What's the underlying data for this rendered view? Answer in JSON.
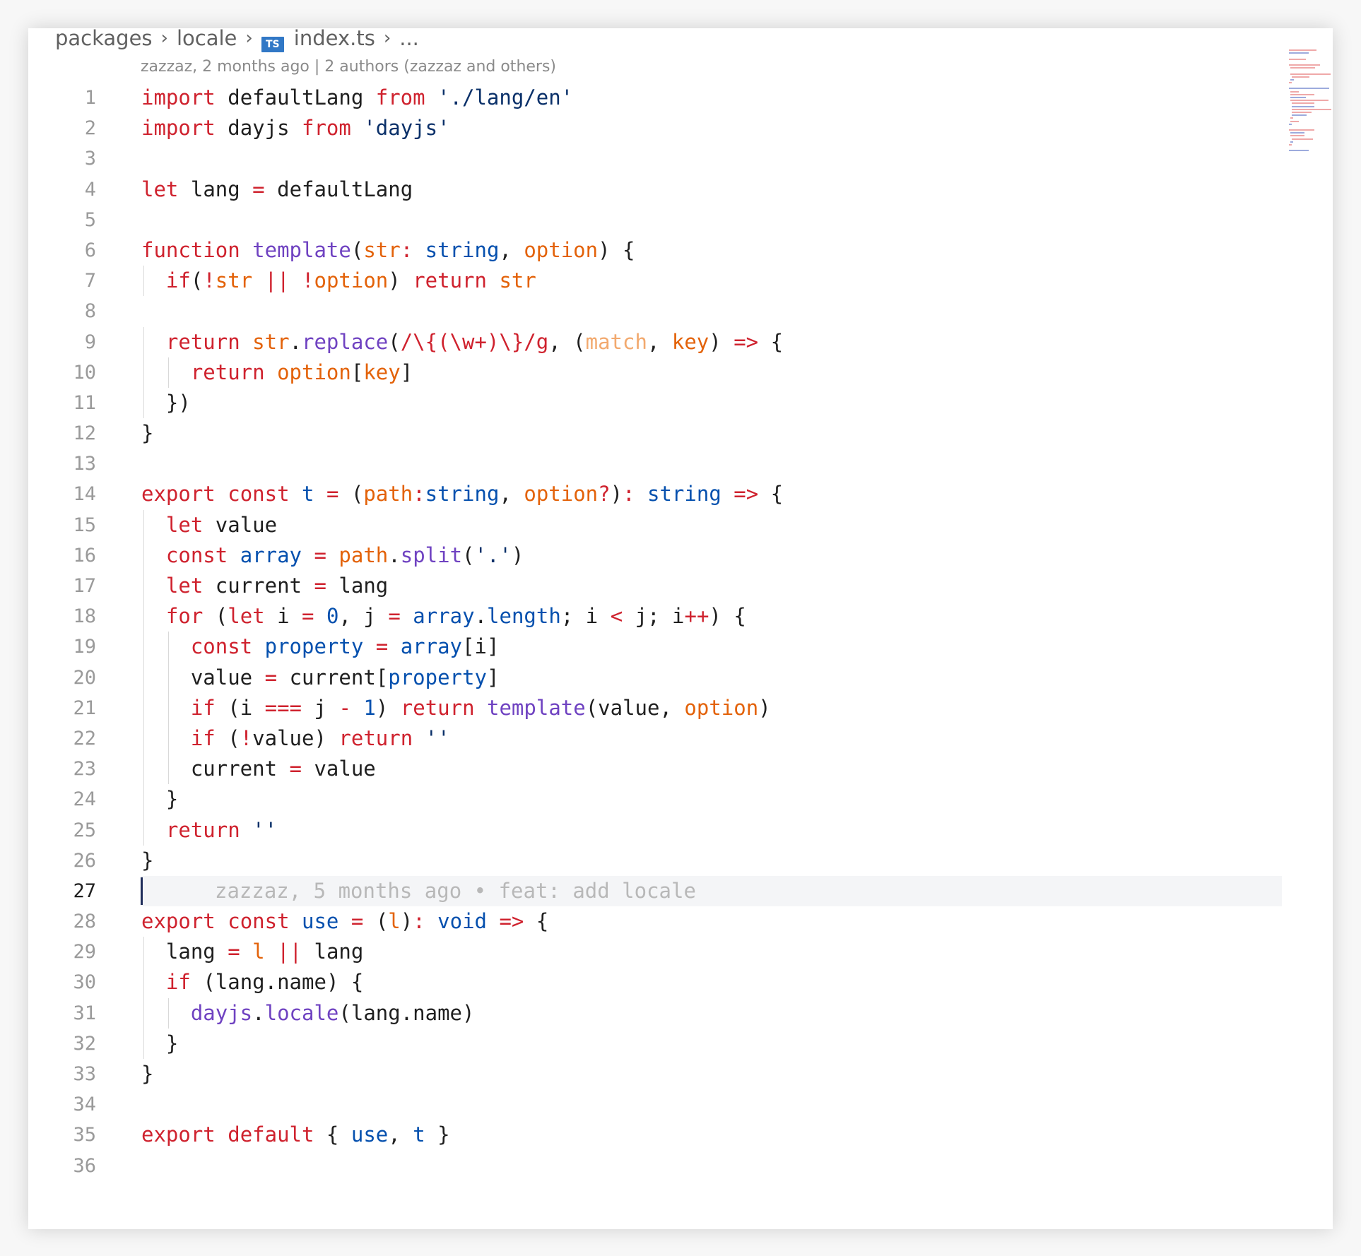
{
  "breadcrumb": {
    "segments": [
      "packages",
      "locale",
      "index.ts",
      "..."
    ],
    "separator": "›",
    "file_badge": "TS"
  },
  "codelens": "zazzaz, 2 months ago | 2 authors (zazzaz and others)",
  "editor": {
    "current_line": 27,
    "blame": "zazzaz, 5 months ago • feat: add locale",
    "theme_colors": {
      "keyword": "#cf222e",
      "param": "#e36209",
      "function": "#6f42c1",
      "type": "#0550ae",
      "string": "#0a3069",
      "plain": "#1f1f1f",
      "unused": "#f2a96e",
      "regex_escape": "#116329"
    },
    "lines": [
      "import defaultLang from './lang/en'",
      "import dayjs from 'dayjs'",
      "",
      "let lang = defaultLang",
      "",
      "function template(str: string, option) {",
      "  if(!str || !option) return str",
      "",
      "  return str.replace(/\\{(\\w+)\\}/g, (match, key) => {",
      "    return option[key]",
      "  })",
      "}",
      "",
      "export const t = (path:string, option?): string => {",
      "  let value",
      "  const array = path.split('.')",
      "  let current = lang",
      "  for (let i = 0, j = array.length; i < j; i++) {",
      "    const property = array[i]",
      "    value = current[property]",
      "    if (i === j - 1) return template(value, option)",
      "    if (!value) return ''",
      "    current = value",
      "  }",
      "  return ''",
      "}",
      "",
      "export const use = (l): void => {",
      "  lang = l || lang",
      "  if (lang.name) {",
      "    dayjs.locale(lang.name)",
      "  }",
      "}",
      "",
      "export default { use, t }",
      ""
    ]
  }
}
